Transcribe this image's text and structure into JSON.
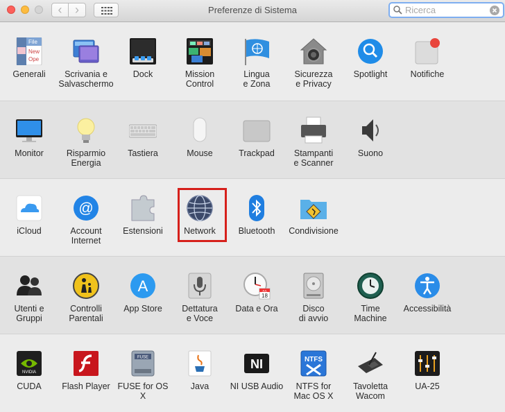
{
  "window": {
    "title": "Preferenze di Sistema",
    "back_glyph": "‹",
    "forward_glyph": "›"
  },
  "search": {
    "placeholder": "Ricerca",
    "value": ""
  },
  "rows": [
    [
      {
        "label": "Generali",
        "icon": "file-general-icon"
      },
      {
        "label": "Scrivania e\nSalvaschermo",
        "icon": "desktop-screensaver-icon"
      },
      {
        "label": "Dock",
        "icon": "dock-icon"
      },
      {
        "label": "Mission\nControl",
        "icon": "mission-control-icon"
      },
      {
        "label": "Lingua\ne Zona",
        "icon": "language-flag-icon"
      },
      {
        "label": "Sicurezza\ne Privacy",
        "icon": "security-house-icon"
      },
      {
        "label": "Spotlight",
        "icon": "spotlight-magnifier-icon"
      },
      {
        "label": "Notifiche",
        "icon": "notifications-icon"
      }
    ],
    [
      {
        "label": "Monitor",
        "icon": "monitor-icon"
      },
      {
        "label": "Risparmio\nEnergia",
        "icon": "energy-bulb-icon"
      },
      {
        "label": "Tastiera",
        "icon": "keyboard-icon"
      },
      {
        "label": "Mouse",
        "icon": "mouse-icon"
      },
      {
        "label": "Trackpad",
        "icon": "trackpad-icon"
      },
      {
        "label": "Stampanti\ne Scanner",
        "icon": "printer-icon"
      },
      {
        "label": "Suono",
        "icon": "speaker-icon"
      }
    ],
    [
      {
        "label": "iCloud",
        "icon": "icloud-icon"
      },
      {
        "label": "Account\nInternet",
        "icon": "internet-accounts-icon"
      },
      {
        "label": "Estensioni",
        "icon": "extensions-puzzle-icon"
      },
      {
        "label": "Network",
        "icon": "network-globe-icon"
      },
      {
        "label": "Bluetooth",
        "icon": "bluetooth-icon"
      },
      {
        "label": "Condivisione",
        "icon": "sharing-folder-icon"
      }
    ],
    [
      {
        "label": "Utenti e\nGruppi",
        "icon": "users-groups-icon"
      },
      {
        "label": "Controlli\nParentali",
        "icon": "parental-controls-icon"
      },
      {
        "label": "App Store",
        "icon": "app-store-icon"
      },
      {
        "label": "Dettatura\ne Voce",
        "icon": "dictation-mic-icon"
      },
      {
        "label": "Data e Ora",
        "icon": "date-time-clock-icon"
      },
      {
        "label": "Disco\ndi avvio",
        "icon": "startup-disk-icon"
      },
      {
        "label": "Time\nMachine",
        "icon": "time-machine-icon"
      },
      {
        "label": "Accessibilità",
        "icon": "accessibility-icon"
      }
    ],
    [
      {
        "label": "CUDA",
        "icon": "cuda-nvidia-icon"
      },
      {
        "label": "Flash Player",
        "icon": "flash-player-icon"
      },
      {
        "label": "FUSE for OS X",
        "icon": "fuse-drive-icon"
      },
      {
        "label": "Java",
        "icon": "java-cup-icon"
      },
      {
        "label": "NI USB Audio",
        "icon": "ni-usb-audio-icon"
      },
      {
        "label": "NTFS for\nMac OS X",
        "icon": "ntfs-icon"
      },
      {
        "label": "Tavoletta Wacom",
        "icon": "wacom-tablet-icon"
      },
      {
        "label": "UA-25",
        "icon": "ua25-mixer-icon"
      }
    ]
  ],
  "icon_texts": {
    "generali_file": "File",
    "generali_new": "New",
    "generali_open": "Ope",
    "datetime_month": "JUL",
    "datetime_day": "18",
    "fuse": "FUSE",
    "cuda": "NVIDIA",
    "ni": "NI",
    "ntfs": "NTFS",
    "app_store": "A",
    "account_at": "@"
  },
  "selected_pane": "Network",
  "colors": {
    "highlight": "#d6201b",
    "search_focus": "#7eaef0"
  }
}
